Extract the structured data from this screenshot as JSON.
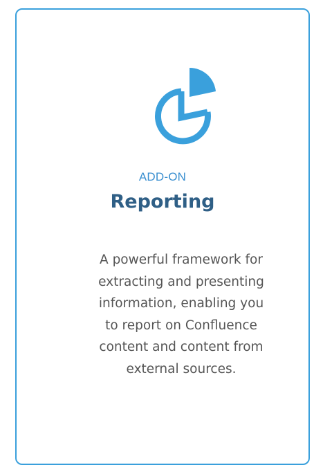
{
  "card": {
    "icon": "pie-chart-icon",
    "eyebrow": "ADD-ON",
    "title": "Reporting",
    "description": "A powerful framework for\nextracting and presenting\ninformation, enabling you\nto report on Confluence\ncontent and content from\nexternal sources."
  },
  "colors": {
    "accent": "#3aa0dc",
    "title": "#2f5f86",
    "text": "#555555"
  }
}
